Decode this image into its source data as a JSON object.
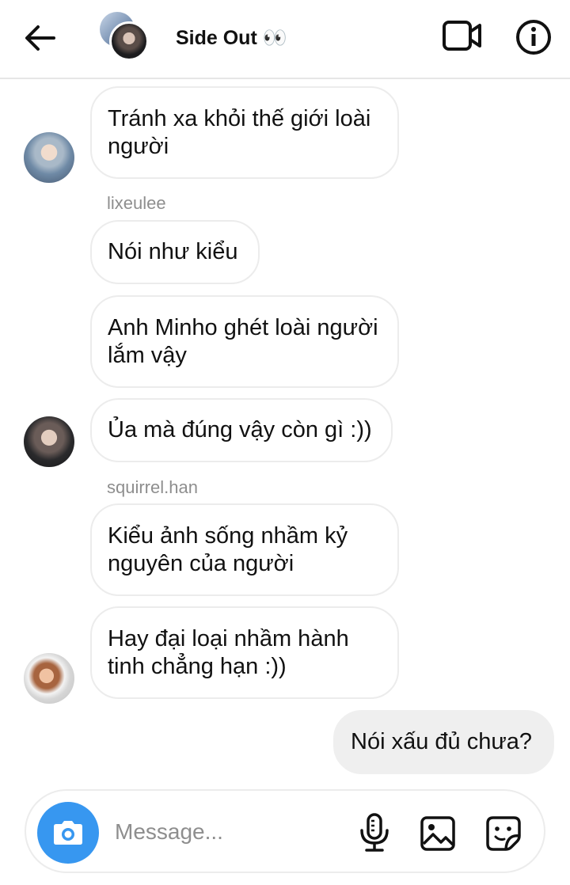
{
  "header": {
    "title": "Side Out 👀",
    "icons": {
      "back": "arrow-left-icon",
      "video": "video-call-icon",
      "info": "info-icon"
    }
  },
  "messages": [
    {
      "text": "Tránh xa khỏi thế giới loài người"
    },
    {
      "sender": "lixeulee"
    },
    {
      "text": "Nói như kiểu"
    },
    {
      "text": "Anh Minho ghét loài người lắm vậy"
    },
    {
      "text": "Ủa mà đúng vậy còn gì :))"
    },
    {
      "sender": "squirrel.han"
    },
    {
      "text": "Kiểu ảnh sống nhầm kỷ nguyên của người"
    },
    {
      "text": "Hay đại loại nhầm hành tinh chẳng hạn :))"
    },
    {
      "text": "Nói xấu đủ chưa?",
      "outgoing": true
    }
  ],
  "composer": {
    "placeholder": "Message...",
    "icons": [
      "camera-icon",
      "microphone-icon",
      "gallery-icon",
      "sticker-icon"
    ]
  },
  "colors": {
    "accent": "#3797f0",
    "incoming_border": "#ececec",
    "outgoing_bg": "#efefef",
    "secondary_text": "#8e8e8e"
  }
}
